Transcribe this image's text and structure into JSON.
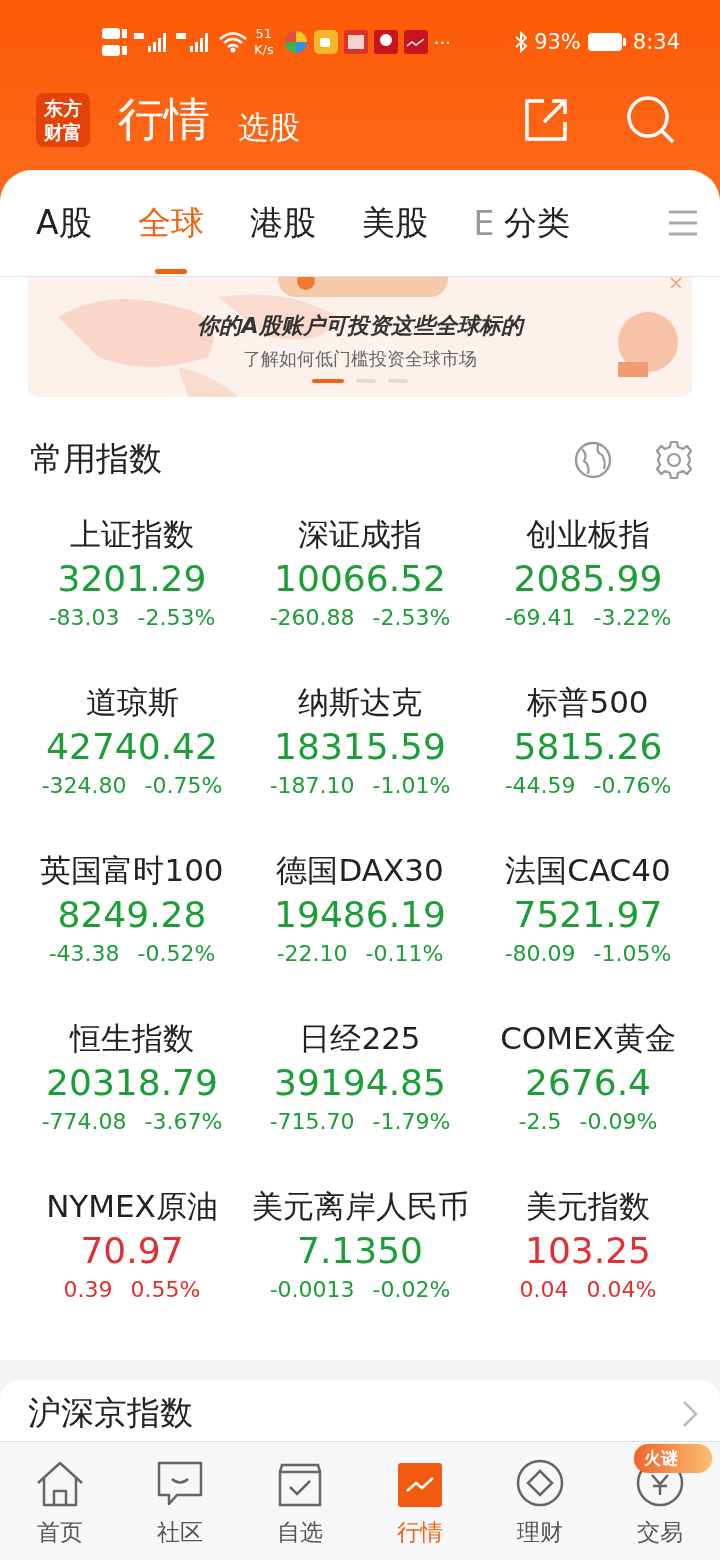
{
  "status_bar": {
    "speed": "51",
    "speed_unit": "K/s",
    "more": "···",
    "battery": "93%",
    "time": "8:34"
  },
  "header": {
    "logo": "东方财富",
    "title": "行情",
    "subtitle": "选股"
  },
  "tabs": [
    {
      "label": "A股",
      "selected": false
    },
    {
      "label": "全球",
      "selected": true
    },
    {
      "label": "港股",
      "selected": false
    },
    {
      "label": "美股",
      "selected": false
    },
    {
      "label": "E",
      "selected": false
    },
    {
      "label": "分类",
      "selected": false
    }
  ],
  "banner": {
    "headline": "你的A股账户可投资这些全球标的",
    "subline": "了解如何低门槛投资全球市场",
    "pages": [
      {
        "selected": true
      },
      {
        "selected": false
      },
      {
        "selected": false
      }
    ]
  },
  "section": {
    "title": "常用指数"
  },
  "indices": [
    {
      "name": "上证指数",
      "value": "3201.29",
      "change": "-83.03",
      "percent": "-2.53%",
      "rising": false
    },
    {
      "name": "深证成指",
      "value": "10066.52",
      "change": "-260.88",
      "percent": "-2.53%",
      "rising": false
    },
    {
      "name": "创业板指",
      "value": "2085.99",
      "change": "-69.41",
      "percent": "-3.22%",
      "rising": false
    },
    {
      "name": "道琼斯",
      "value": "42740.42",
      "change": "-324.80",
      "percent": "-0.75%",
      "rising": false
    },
    {
      "name": "纳斯达克",
      "value": "18315.59",
      "change": "-187.10",
      "percent": "-1.01%",
      "rising": false
    },
    {
      "name": "标普500",
      "value": "5815.26",
      "change": "-44.59",
      "percent": "-0.76%",
      "rising": false
    },
    {
      "name": "英国富时100",
      "value": "8249.28",
      "change": "-43.38",
      "percent": "-0.52%",
      "rising": false
    },
    {
      "name": "德国DAX30",
      "value": "19486.19",
      "change": "-22.10",
      "percent": "-0.11%",
      "rising": false
    },
    {
      "name": "法国CAC40",
      "value": "7521.97",
      "change": "-80.09",
      "percent": "-1.05%",
      "rising": false
    },
    {
      "name": "恒生指数",
      "value": "20318.79",
      "change": "-774.08",
      "percent": "-3.67%",
      "rising": false
    },
    {
      "name": "日经225",
      "value": "39194.85",
      "change": "-715.70",
      "percent": "-1.79%",
      "rising": false
    },
    {
      "name": "COMEX黄金",
      "value": "2676.4",
      "change": "-2.5",
      "percent": "-0.09%",
      "rising": false
    },
    {
      "name": "NYMEX原油",
      "value": "70.97",
      "change": "0.39",
      "percent": "0.55%",
      "rising": true
    },
    {
      "name": "美元离岸人民币",
      "value": "7.1350",
      "change": "-0.0013",
      "percent": "-0.02%",
      "rising": false
    },
    {
      "name": "美元指数",
      "value": "103.25",
      "change": "0.04",
      "percent": "0.04%",
      "rising": true
    }
  ],
  "next_section": {
    "title": "沪深京指数"
  },
  "nav": [
    {
      "label": "首页",
      "kind": "home",
      "selected": false
    },
    {
      "label": "社区",
      "kind": "chat",
      "selected": false
    },
    {
      "label": "自选",
      "kind": "check",
      "selected": false
    },
    {
      "label": "行情",
      "kind": "chart",
      "selected": true
    },
    {
      "label": "理财",
      "kind": "diamond",
      "selected": false
    },
    {
      "label": "交易",
      "kind": "yen",
      "selected": false,
      "badge": "火谜"
    }
  ]
}
